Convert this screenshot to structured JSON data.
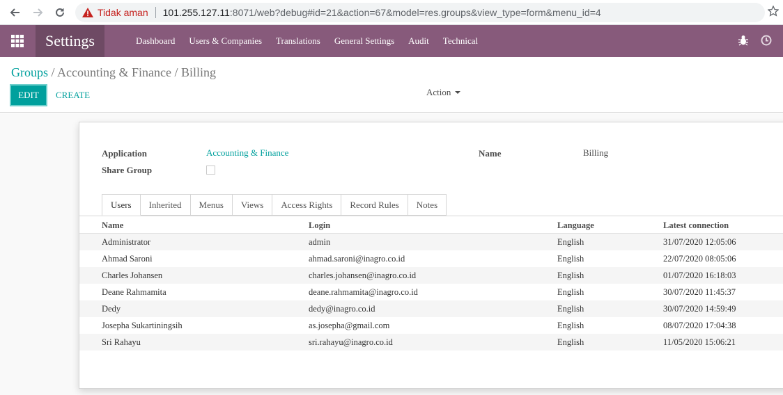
{
  "browser": {
    "warning": "Tidak aman",
    "url_host": "101.255.127.11",
    "url_rest": ":8071/web?debug#id=21&action=67&model=res.groups&view_type=form&menu_id=4"
  },
  "navbar": {
    "brand": "Settings",
    "menu": [
      "Dashboard",
      "Users & Companies",
      "Translations",
      "General Settings",
      "Audit",
      "Technical"
    ],
    "icons": [
      "bug-icon",
      "clock-icon"
    ]
  },
  "control": {
    "breadcrumb_link": "Groups",
    "breadcrumb_current": "/ Accounting & Finance / Billing",
    "edit_label": "EDIT",
    "create_label": "CREATE",
    "action_label": "Action"
  },
  "form": {
    "application_label": "Application",
    "application_value": "Accounting & Finance",
    "share_group_label": "Share Group",
    "share_group_checked": false,
    "name_label": "Name",
    "name_value": "Billing"
  },
  "tabs": [
    "Users",
    "Inherited",
    "Menus",
    "Views",
    "Access Rights",
    "Record Rules",
    "Notes"
  ],
  "table": {
    "columns": [
      "Name",
      "Login",
      "Language",
      "Latest connection"
    ],
    "rows": [
      [
        "Administrator",
        "admin",
        "English",
        "31/07/2020 12:05:06"
      ],
      [
        "Ahmad Saroni",
        "ahmad.saroni@inagro.co.id",
        "English",
        "22/07/2020 08:05:06"
      ],
      [
        "Charles Johansen",
        "charles.johansen@inagro.co.id",
        "English",
        "01/07/2020 16:18:03"
      ],
      [
        "Deane Rahmamita",
        "deane.rahmamita@inagro.co.id",
        "English",
        "30/07/2020 11:45:37"
      ],
      [
        "Dedy",
        "dedy@inagro.co.id",
        "English",
        "30/07/2020 14:59:49"
      ],
      [
        "Josepha Sukartiningsih",
        "as.josepha@gmail.com",
        "English",
        "08/07/2020 17:04:38"
      ],
      [
        "Sri Rahayu",
        "sri.rahayu@inagro.co.id",
        "English",
        "11/05/2020 15:06:21"
      ]
    ]
  },
  "colors": {
    "navbar": "#875a7b",
    "brand_bg": "#6e4a64",
    "accent": "#00a09d"
  }
}
